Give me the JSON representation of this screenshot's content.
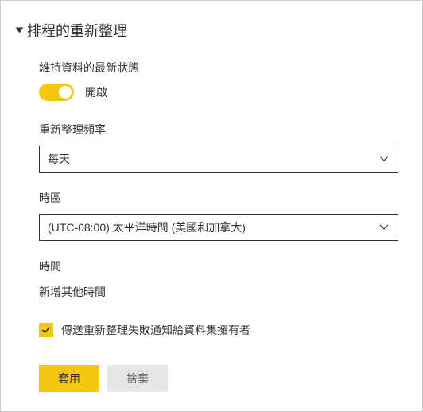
{
  "header": {
    "title": "排程的重新整理"
  },
  "keepUpdated": {
    "label": "維持資料的最新狀態",
    "stateLabel": "開啟"
  },
  "frequency": {
    "label": "重新整理頻率",
    "value": "每天"
  },
  "timezone": {
    "label": "時區",
    "value": "(UTC-08:00) 太平洋時間 (美國和加拿大)"
  },
  "time": {
    "label": "時間",
    "addLink": "新增其他時間"
  },
  "notify": {
    "label": "傳送重新整理失敗通知給資料集擁有者"
  },
  "buttons": {
    "apply": "套用",
    "discard": "捨棄"
  }
}
